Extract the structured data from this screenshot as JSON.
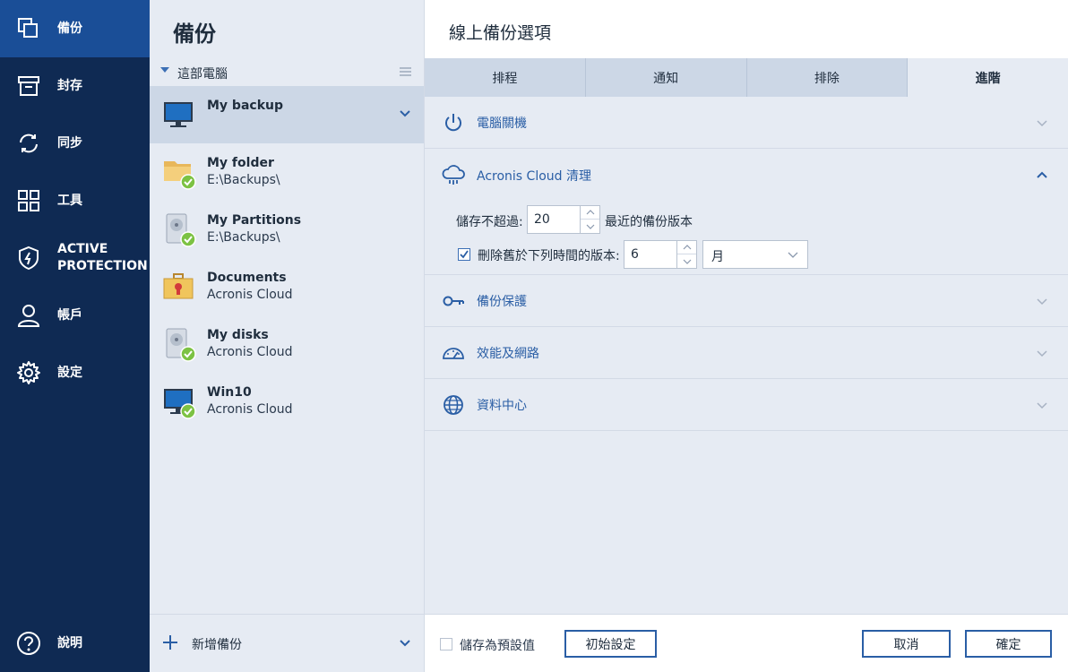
{
  "sidebar": {
    "items": [
      {
        "label": "備份",
        "icon": "copy-icon"
      },
      {
        "label": "封存",
        "icon": "archive-icon"
      },
      {
        "label": "同步",
        "icon": "sync-icon"
      },
      {
        "label": "工具",
        "icon": "tools-grid-icon"
      },
      {
        "label": "ACTIVE\nPROTECTION",
        "icon": "shield-icon"
      },
      {
        "label": "帳戶",
        "icon": "user-icon"
      },
      {
        "label": "設定",
        "icon": "gear-icon"
      }
    ],
    "help_label": "說明"
  },
  "list": {
    "title": "備份",
    "group_label": "這部電腦",
    "items": [
      {
        "name": "My backup",
        "sub": "",
        "icon": "monitor-icon"
      },
      {
        "name": "My folder",
        "sub": "E:\\Backups\\",
        "icon": "folder-icon"
      },
      {
        "name": "My Partitions",
        "sub": "E:\\Backups\\",
        "icon": "disk-icon"
      },
      {
        "name": "Documents",
        "sub": "Acronis Cloud",
        "icon": "briefcase-icon"
      },
      {
        "name": "My disks",
        "sub": "Acronis Cloud",
        "icon": "disk-icon"
      },
      {
        "name": "Win10",
        "sub": "Acronis Cloud",
        "icon": "monitor-icon"
      }
    ],
    "add_label": "新增備份"
  },
  "options": {
    "title": "線上備份選項",
    "tabs": [
      "排程",
      "通知",
      "排除",
      "進階"
    ],
    "active_tab": "進階",
    "sections": {
      "shutdown": "電腦關機",
      "cloud_cleanup": "Acronis Cloud 清理",
      "protection": "備份保護",
      "performance": "效能及網路",
      "datacenter": "資料中心"
    },
    "cleanup": {
      "keep_label": "儲存不超過:",
      "keep_value": "20",
      "keep_after": "最近的備份版本",
      "delete_label": "刪除舊於下列時間的版本:",
      "delete_value": "6",
      "delete_unit": "月"
    },
    "footer": {
      "save_default_label": "儲存為預設值",
      "reset_label": "初始設定",
      "cancel_label": "取消",
      "ok_label": "確定"
    }
  },
  "colors": {
    "sidebar_bg": "#0f2a53",
    "sidebar_active": "#1a4e97",
    "panel_bg": "#e6ebf3",
    "accent": "#2a5ea5",
    "success": "#7cc243"
  }
}
